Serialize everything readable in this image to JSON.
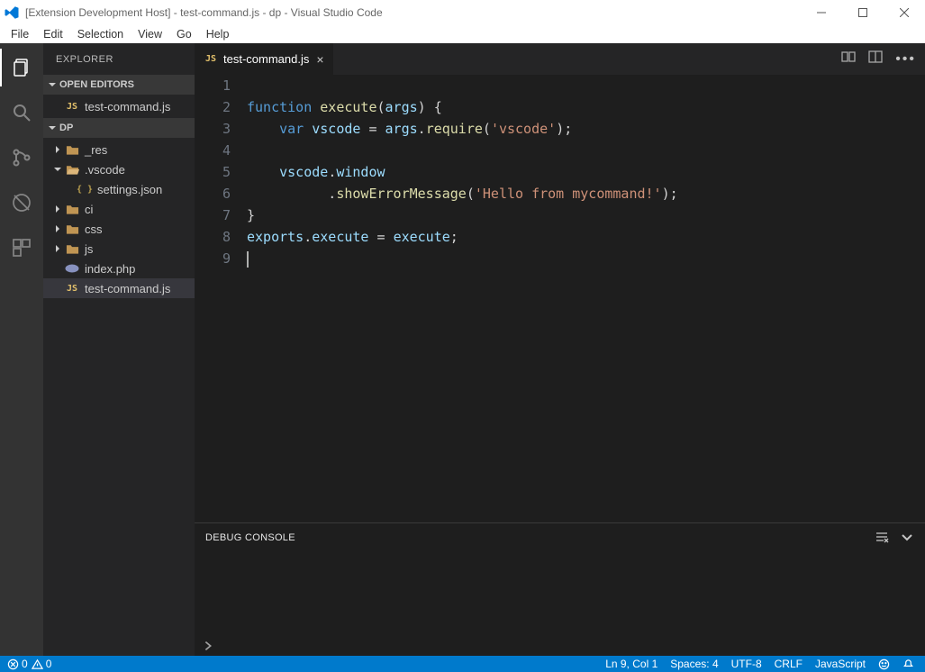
{
  "window": {
    "title": "[Extension Development Host] - test-command.js - dp - Visual Studio Code"
  },
  "menubar": [
    "File",
    "Edit",
    "Selection",
    "View",
    "Go",
    "Help"
  ],
  "sidebar": {
    "title": "EXPLORER",
    "sections": {
      "open_editors": {
        "label": "OPEN EDITORS",
        "items": [
          {
            "icon": "js",
            "label": "test-command.js"
          }
        ]
      },
      "workspace": {
        "label": "DP",
        "items": [
          {
            "indent": 0,
            "twisty": "collapsed",
            "icon": "folder",
            "label": "_res",
            "name": "folder-res"
          },
          {
            "indent": 0,
            "twisty": "expanded",
            "icon": "folder-open",
            "label": ".vscode",
            "name": "folder-vscode"
          },
          {
            "indent": 1,
            "twisty": "none",
            "icon": "json",
            "label": "settings.json",
            "name": "file-settings"
          },
          {
            "indent": 0,
            "twisty": "collapsed",
            "icon": "folder",
            "label": "ci",
            "name": "folder-ci"
          },
          {
            "indent": 0,
            "twisty": "collapsed",
            "icon": "folder",
            "label": "css",
            "name": "folder-css"
          },
          {
            "indent": 0,
            "twisty": "collapsed",
            "icon": "folder",
            "label": "js",
            "name": "folder-js"
          },
          {
            "indent": 0,
            "twisty": "none",
            "icon": "php",
            "label": "index.php",
            "name": "file-index"
          },
          {
            "indent": 0,
            "twisty": "none",
            "icon": "js",
            "label": "test-command.js",
            "name": "file-test-command",
            "selected": true
          }
        ]
      }
    }
  },
  "tabs": [
    {
      "icon": "js",
      "label": "test-command.js",
      "active": true
    }
  ],
  "editor": {
    "lines": [
      [],
      [
        [
          "kw",
          "function"
        ],
        [
          "pun",
          " "
        ],
        [
          "fn",
          "execute"
        ],
        [
          "pun",
          "("
        ],
        [
          "var",
          "args"
        ],
        [
          "pun",
          ") {"
        ]
      ],
      [
        [
          "pun",
          "    "
        ],
        [
          "kw",
          "var"
        ],
        [
          "pun",
          " "
        ],
        [
          "var",
          "vscode"
        ],
        [
          "pun",
          " = "
        ],
        [
          "var",
          "args"
        ],
        [
          "pun",
          "."
        ],
        [
          "fn",
          "require"
        ],
        [
          "pun",
          "("
        ],
        [
          "str",
          "'vscode'"
        ],
        [
          "pun",
          ");"
        ]
      ],
      [],
      [
        [
          "pun",
          "    "
        ],
        [
          "var",
          "vscode"
        ],
        [
          "pun",
          "."
        ],
        [
          "var",
          "window"
        ]
      ],
      [
        [
          "pun",
          "          ."
        ],
        [
          "fn",
          "showErrorMessage"
        ],
        [
          "pun",
          "("
        ],
        [
          "str",
          "'Hello from mycommand!'"
        ],
        [
          "pun",
          ");"
        ]
      ],
      [
        [
          "pun",
          "}"
        ]
      ],
      [
        [
          "var",
          "exports"
        ],
        [
          "pun",
          "."
        ],
        [
          "var",
          "execute"
        ],
        [
          "pun",
          " = "
        ],
        [
          "var",
          "execute"
        ],
        [
          "pun",
          ";"
        ]
      ],
      []
    ]
  },
  "panel": {
    "title": "DEBUG CONSOLE"
  },
  "statusbar": {
    "errors": "0",
    "warnings": "0",
    "cursor": "Ln 9, Col 1",
    "spaces": "Spaces: 4",
    "encoding": "UTF-8",
    "eol": "CRLF",
    "language": "JavaScript"
  }
}
